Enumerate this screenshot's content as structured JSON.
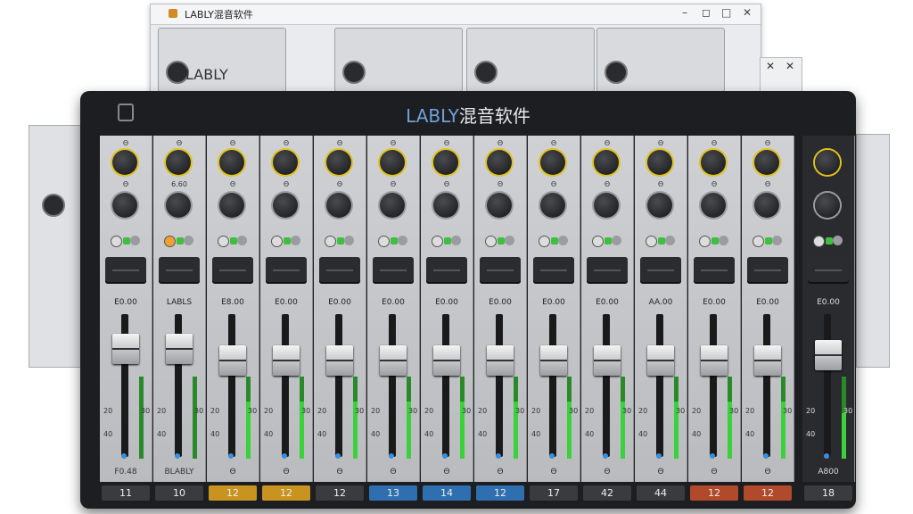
{
  "background_window": {
    "title": "LABLY混音软件",
    "controls": [
      "–",
      "◻",
      "□",
      "✕"
    ],
    "strip_labels": [
      "LABLY",
      "",
      "",
      ""
    ]
  },
  "mini_window": {
    "controls": [
      "✕",
      "✕"
    ]
  },
  "mixer": {
    "title_prefix": "LABLY",
    "title_suffix": "混音软件",
    "accent_color": "#6fa2d8",
    "channels": [
      {
        "k1": "Θ",
        "k2": "Θ",
        "db": "E0.00",
        "top": "",
        "bot": "F0.48",
        "num": "11",
        "color": "#3a3b3e",
        "fader": 0.86,
        "meter": 0.0
      },
      {
        "k1": "Θ",
        "k2": "6.60",
        "db": "LABLS",
        "top": "",
        "bot": "BLABLY",
        "num": "10",
        "color": "#3a3b3e",
        "fader": 0.86,
        "meter": 0.0
      },
      {
        "k1": "Θ",
        "k2": "Θ",
        "db": "E8.00",
        "top": "",
        "bot": "Θ",
        "num": "12",
        "color": "#c8941f",
        "fader": 0.78,
        "meter": 0.7
      },
      {
        "k1": "Θ",
        "k2": "Θ",
        "db": "E0.00",
        "top": "",
        "bot": "Θ",
        "num": "12",
        "color": "#c8941f",
        "fader": 0.78,
        "meter": 0.7
      },
      {
        "k1": "Θ",
        "k2": "Θ",
        "db": "E0.00",
        "top": "",
        "bot": "Θ",
        "num": "12",
        "color": "#3a3b3e",
        "fader": 0.78,
        "meter": 0.7
      },
      {
        "k1": "Θ",
        "k2": "Θ",
        "db": "E0.00",
        "top": "",
        "bot": "Θ",
        "num": "13",
        "color": "#2f6fb0",
        "fader": 0.78,
        "meter": 0.7
      },
      {
        "k1": "Θ",
        "k2": "Θ",
        "db": "E0.00",
        "top": "",
        "bot": "Θ",
        "num": "14",
        "color": "#2f6fb0",
        "fader": 0.78,
        "meter": 0.7
      },
      {
        "k1": "Θ",
        "k2": "Θ",
        "db": "E0.00",
        "top": "",
        "bot": "Θ",
        "num": "12",
        "color": "#2f6fb0",
        "fader": 0.78,
        "meter": 0.7
      },
      {
        "k1": "Θ",
        "k2": "Θ",
        "db": "E0.00",
        "top": "",
        "bot": "Θ",
        "num": "17",
        "color": "#3a3b3e",
        "fader": 0.78,
        "meter": 0.7
      },
      {
        "k1": "Θ",
        "k2": "Θ",
        "db": "E0.00",
        "top": "",
        "bot": "Θ",
        "num": "42",
        "color": "#3a3b3e",
        "fader": 0.78,
        "meter": 0.7
      },
      {
        "k1": "Θ",
        "k2": "Θ",
        "db": "AA.00",
        "top": "",
        "bot": "Θ",
        "num": "44",
        "color": "#3a3b3e",
        "fader": 0.78,
        "meter": 0.7
      },
      {
        "k1": "Θ",
        "k2": "Θ",
        "db": "E0.00",
        "top": "",
        "bot": "Θ",
        "num": "12",
        "color": "#b04a2a",
        "fader": 0.78,
        "meter": 0.7
      },
      {
        "k1": "Θ",
        "k2": "Θ",
        "db": "E0.00",
        "top": "",
        "bot": "Θ",
        "num": "12",
        "color": "#b04a2a",
        "fader": 0.78,
        "meter": 0.7
      },
      {
        "k1": "",
        "k2": "",
        "db": "E0.00",
        "top": "",
        "bot": "A800",
        "num": "18",
        "color": "#3a3b3e",
        "fader": 0.82,
        "meter": 0.55
      }
    ],
    "scale": {
      "s20": "20",
      "s40": "40",
      "s30": "30",
      "s50": "50"
    }
  }
}
